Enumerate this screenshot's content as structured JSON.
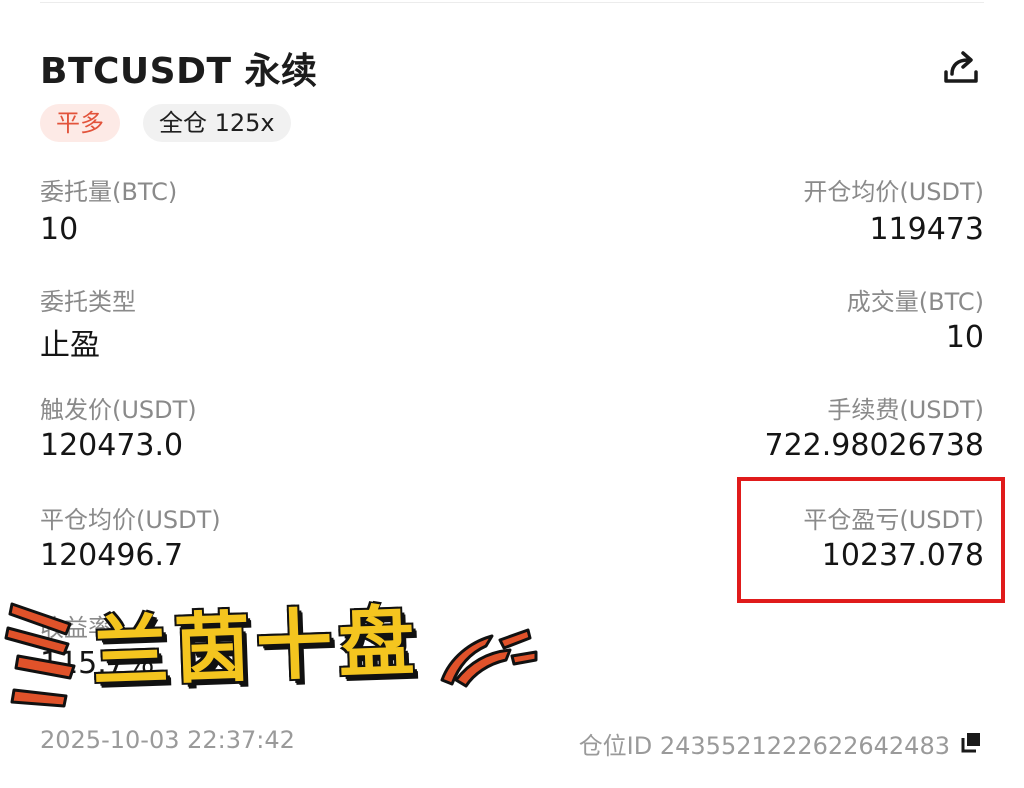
{
  "header": {
    "title": "BTCUSDT 永续",
    "share_icon": "share-icon"
  },
  "tags": {
    "side": "平多",
    "margin": "全仓 125x"
  },
  "fields": {
    "order_qty_label": "委托量(BTC)",
    "order_qty_value": "10",
    "open_avg_label": "开仓均价(USDT)",
    "open_avg_value": "119473",
    "order_type_label": "委托类型",
    "order_type_value": "止盈",
    "filled_qty_label": "成交量(BTC)",
    "filled_qty_value": "10",
    "trigger_label": "触发价(USDT)",
    "trigger_value": "120473.0",
    "fee_label": "手续费(USDT)",
    "fee_value": "722.98026738",
    "close_avg_label": "平仓均价(USDT)",
    "close_avg_value": "120496.7",
    "pnl_label": "平仓盈亏(USDT)",
    "pnl_value": "10237.078",
    "yield_label": "收益率",
    "yield_value": "115.7%"
  },
  "footer": {
    "timestamp": "2025-10-03 22:37:42",
    "position_id": "仓位ID 2435521222622642483",
    "copy_icon": "copy-icon"
  },
  "overlay": {
    "sticker_text": "兰茵十盘"
  },
  "colors": {
    "side_tag_bg": "#fdeae6",
    "side_tag_text": "#e2533b",
    "highlight_border": "#e01b1b",
    "sticker_fill": "#f4c51f",
    "stroke_accent": "#e0522a"
  }
}
